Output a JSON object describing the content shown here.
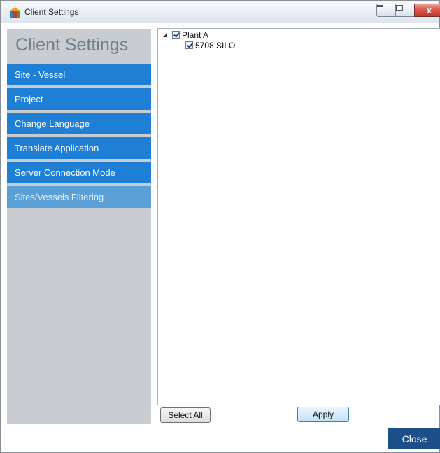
{
  "window": {
    "title": "Client Settings",
    "controls": {
      "minimize_icon": "minimize-icon",
      "maximize_icon": "maximize-icon",
      "close_glyph": "x"
    }
  },
  "sidebar": {
    "title": "Client Settings",
    "items": [
      {
        "label": "Site - Vessel",
        "active": false
      },
      {
        "label": "Project",
        "active": false
      },
      {
        "label": "Change Language",
        "active": false
      },
      {
        "label": "Translate Application",
        "active": false
      },
      {
        "label": "Server Connection Mode",
        "active": false
      },
      {
        "label": "Sites/Vessels Filtering",
        "active": true
      }
    ]
  },
  "tree": {
    "nodes": [
      {
        "label": "Plant A",
        "checked": true,
        "expanded": true,
        "children": [
          {
            "label": "5708 SILO",
            "checked": true
          }
        ]
      }
    ]
  },
  "buttons": {
    "select_all": "Select All",
    "apply": "Apply",
    "close": "Close"
  },
  "colors": {
    "nav_blue": "#1e7fd4",
    "nav_active": "#5a9fd6",
    "sidebar_bg": "#c9cdd2",
    "close_button": "#1d4f8a"
  }
}
